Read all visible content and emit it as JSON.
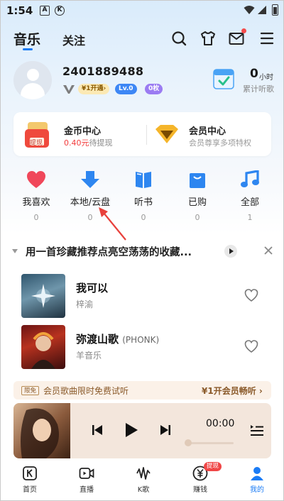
{
  "status_bar": {
    "time": "1:54",
    "icon_a": "A",
    "icon_k": "K"
  },
  "top_nav": {
    "tab_music": "音乐",
    "tab_follow": "关注",
    "icons": [
      "search-icon",
      "tshirt-icon",
      "mail-icon",
      "menu-icon"
    ]
  },
  "profile": {
    "user_id": "2401889488",
    "badge_open": "¥1开通›",
    "badge_level": "Lv.0",
    "badge_gold": "0枚",
    "listen_hours": "0",
    "listen_unit": "小时",
    "listen_label": "累计听歌"
  },
  "coin_center": {
    "title": "金币中心",
    "amount": "0.40元",
    "suffix": "待提现",
    "icon_text": "提现"
  },
  "vip_center": {
    "title": "会员中心",
    "subtitle": "会员尊享多项特权"
  },
  "quick_items": [
    {
      "label": "我喜欢",
      "count": "0"
    },
    {
      "label": "本地/云盘",
      "count": "0"
    },
    {
      "label": "听书",
      "count": "0"
    },
    {
      "label": "已购",
      "count": "0"
    },
    {
      "label": "全部",
      "count": "1"
    }
  ],
  "recommendation": {
    "title": "用一首珍藏推荐点亮空荡荡的收藏...",
    "songs": [
      {
        "title": "我可以",
        "tag": "",
        "artist": "梓渝"
      },
      {
        "title": "弥渡山歌",
        "tag": "(PHONK)",
        "artist": "羊音乐"
      }
    ]
  },
  "promo": {
    "tag": "限免",
    "text": "会员歌曲限时免费试听",
    "cta": "¥1开会员畅听 ›"
  },
  "player": {
    "time": "00:00",
    "progress": 0
  },
  "bottom_nav": [
    {
      "label": "首页",
      "icon": "home-k-icon"
    },
    {
      "label": "直播",
      "icon": "live-icon"
    },
    {
      "label": "K歌",
      "icon": "karaoke-icon"
    },
    {
      "label": "赚钱",
      "icon": "yuan-icon",
      "badge": "提现"
    },
    {
      "label": "我的",
      "icon": "profile-icon",
      "active": true
    }
  ],
  "colors": {
    "accent": "#1b7cf5",
    "heart": "#f0475a",
    "annotation_arrow": "#e8413c",
    "coin_amount": "#f23c3c"
  }
}
